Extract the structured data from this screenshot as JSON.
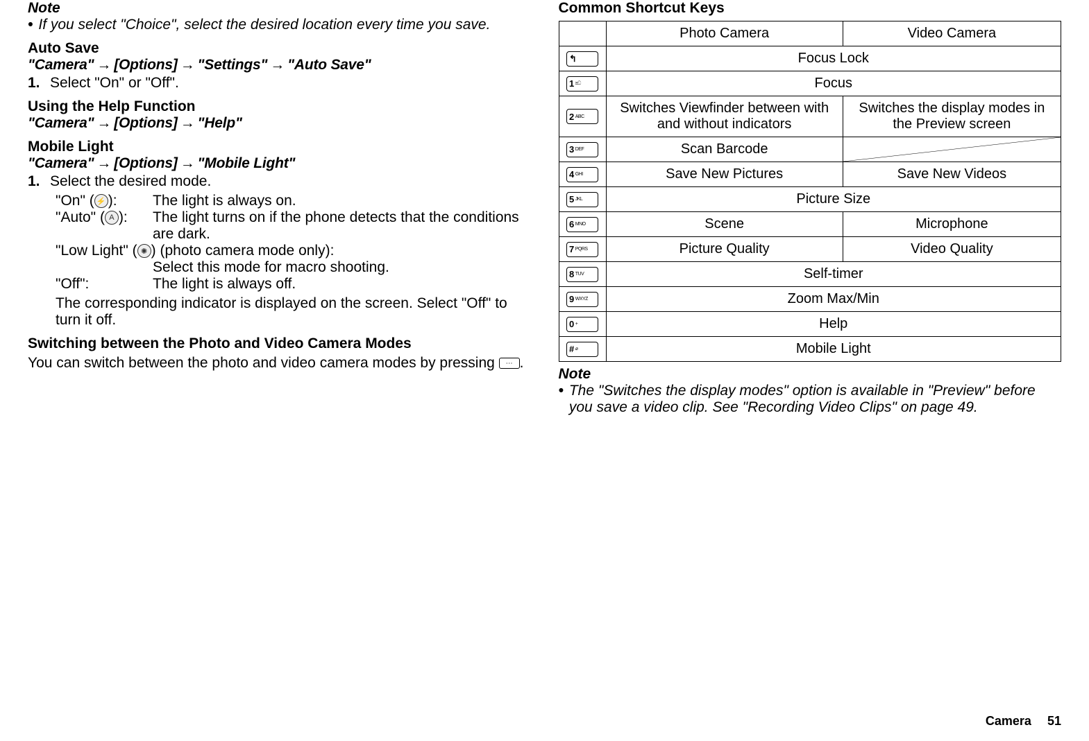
{
  "left": {
    "note_label": "Note",
    "note_text": "If you select \"Choice\", select the desired location every time you save.",
    "auto_save_heading": "Auto Save",
    "auto_save_path": [
      "\"Camera\"",
      "[Options]",
      "\"Settings\"",
      "\"Auto Save\""
    ],
    "auto_save_step_num": "1.",
    "auto_save_step_text": "Select \"On\" or \"Off\".",
    "help_heading": "Using the Help Function",
    "help_path": [
      "\"Camera\"",
      "[Options]",
      "\"Help\""
    ],
    "mobile_light_heading": "Mobile Light",
    "mobile_light_path": [
      "\"Camera\"",
      "[Options]",
      "\"Mobile Light\""
    ],
    "mobile_light_step_num": "1.",
    "mobile_light_step_text": "Select the desired mode.",
    "modes": {
      "on_key": "\"On\" (",
      "on_key_close": "):",
      "on_val": "The light is always on.",
      "auto_key": "\"Auto\" (",
      "auto_key_close": "):",
      "auto_val": "The light turns on if the phone detects that the conditions are dark.",
      "lowlight_key_a": "\"Low Light\" (",
      "lowlight_key_b": ") (photo camera mode only):",
      "lowlight_val": "Select this mode for macro shooting.",
      "off_key": "\"Off\":",
      "off_val": "The light is always off."
    },
    "mobile_light_tail": "The corresponding indicator is displayed on the screen. Select \"Off\" to turn it off.",
    "switch_heading": "Switching between the Photo and Video Camera Modes",
    "switch_text_a": "You can switch between the photo and video camera modes by pressing ",
    "switch_text_b": "."
  },
  "right": {
    "heading": "Common Shortcut Keys",
    "th_photo": "Photo Camera",
    "th_video": "Video Camera",
    "keys": {
      "send": "↰",
      "k1": {
        "d": "1",
        "s": "ඣ"
      },
      "k2": {
        "d": "2",
        "s": "ABC"
      },
      "k3": {
        "d": "3",
        "s": "DEF"
      },
      "k4": {
        "d": "4",
        "s": "GHI"
      },
      "k5": {
        "d": "5",
        "s": "JKL"
      },
      "k6": {
        "d": "6",
        "s": "MNO"
      },
      "k7": {
        "d": "7",
        "s": "PQRS"
      },
      "k8": {
        "d": "8",
        "s": "TUV"
      },
      "k9": {
        "d": "9",
        "s": "WXYZ"
      },
      "k0": {
        "d": "0",
        "s": "+"
      },
      "kh": {
        "d": "#",
        "s": "⌀"
      }
    },
    "rows": {
      "focus_lock": "Focus Lock",
      "focus": "Focus",
      "r2_photo": "Switches Viewfinder between with and without indicators",
      "r2_video": "Switches the display modes in the Preview screen",
      "scan": "Scan Barcode",
      "save_photo": "Save New Pictures",
      "save_video": "Save New Videos",
      "picsize": "Picture Size",
      "scene": "Scene",
      "mic": "Microphone",
      "pq": "Picture Quality",
      "vq": "Video Quality",
      "selftimer": "Self-timer",
      "zoom": "Zoom Max/Min",
      "help": "Help",
      "mlight": "Mobile Light"
    },
    "note_label": "Note",
    "note_text": "The \"Switches the display modes\" option is available in \"Preview\" before you save a video clip. See \"Recording Video Clips\" on page 49."
  },
  "footer": {
    "section": "Camera",
    "page": "51"
  }
}
